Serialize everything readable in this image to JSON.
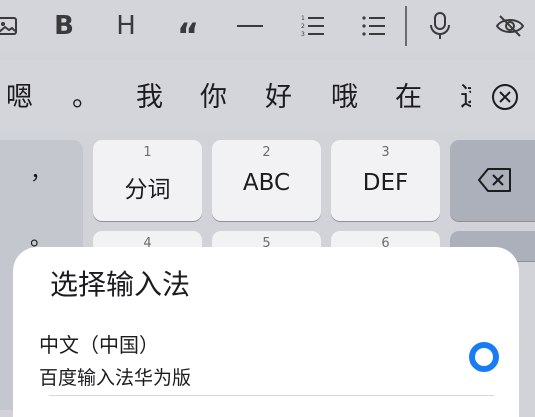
{
  "toolbar": {
    "items": [
      {
        "name": "image-icon"
      },
      {
        "name": "bold-icon",
        "glyph": "B"
      },
      {
        "name": "heading-icon",
        "glyph": "H"
      },
      {
        "name": "quote-icon",
        "glyph": "“"
      },
      {
        "name": "divider-line-icon"
      },
      {
        "name": "numbered-list-icon"
      },
      {
        "name": "bulleted-list-icon"
      },
      {
        "name": "microphone-icon"
      },
      {
        "name": "hide-eye-icon"
      }
    ]
  },
  "candidates": {
    "items": [
      "嗯",
      "。",
      "我",
      "你",
      "好",
      "哦",
      "在",
      "这"
    ]
  },
  "keyboard": {
    "side_punctuation": [
      "，",
      "。"
    ],
    "keys": [
      {
        "num": "1",
        "label": "分词"
      },
      {
        "num": "2",
        "label": "ABC"
      },
      {
        "num": "3",
        "label": "DEF"
      },
      {
        "num": "4",
        "label": ""
      },
      {
        "num": "5",
        "label": ""
      },
      {
        "num": "6",
        "label": ""
      }
    ]
  },
  "sheet": {
    "title": "选择输入法",
    "options": [
      {
        "title": "中文（中国）",
        "subtitle": "百度输入法华为版",
        "selected": true
      }
    ],
    "accent_color": "#1a7cf5"
  }
}
